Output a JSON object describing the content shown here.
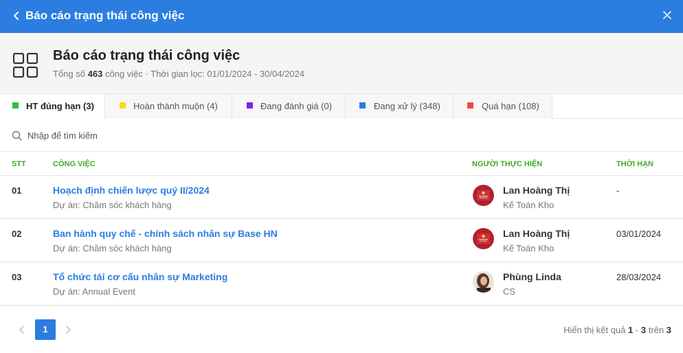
{
  "topbar": {
    "title": "Báo cáo trạng thái công việc",
    "back_icon": "chevron-left-icon",
    "close_icon": "close-icon",
    "color": "#2b7de0"
  },
  "header": {
    "icon": "grid-icon",
    "title": "Báo cáo trạng thái công việc",
    "total_prefix": "Tổng số",
    "total_count": "463",
    "total_suffix": "công việc · Thời gian lọc: 01/01/2024 - 30/04/2024"
  },
  "tabs": [
    {
      "label": "HT đúng hạn (3)",
      "color": "#2ebd3b",
      "active": true
    },
    {
      "label": "Hoàn thành muộn (4)",
      "color": "#f2dd1a",
      "active": false
    },
    {
      "label": "Đang đánh giá (0)",
      "color": "#7a2ae0",
      "active": false
    },
    {
      "label": "Đang xử lý (348)",
      "color": "#2b7de0",
      "active": false
    },
    {
      "label": "Quá hạn (108)",
      "color": "#f04a40",
      "active": false
    }
  ],
  "search": {
    "placeholder": "Nhập để tìm kiếm",
    "value": ""
  },
  "table": {
    "headers": {
      "stt": "STT",
      "task": "CÔNG VIỆC",
      "assignee": "NGƯỜI THỰC HIỆN",
      "deadline": "THỜI HẠN"
    },
    "rows": [
      {
        "stt": "01",
        "task": "Hoạch định chiến lược quý II/2024",
        "project": "Dự án: Chăm sóc khách hàng",
        "name": "Lan Hoàng Thị",
        "role": "Kế Toán Kho",
        "deadline": "-",
        "avatar": "logo-avatar"
      },
      {
        "stt": "02",
        "task": "Ban hành quy chế - chính sách nhân sự Base HN",
        "project": "Dự án: Chăm sóc khách hàng",
        "name": "Lan Hoàng Thị",
        "role": "Kế Toán Kho",
        "deadline": "03/01/2024",
        "avatar": "logo-avatar"
      },
      {
        "stt": "03",
        "task": "Tổ chức tái cơ cấu nhân sự Marketing",
        "project": "Dự án: Annual Event",
        "name": "Phùng Linda",
        "role": "CS",
        "deadline": "28/03/2024",
        "avatar": "photo-avatar"
      }
    ]
  },
  "pagination": {
    "current_page": "1",
    "summary_prefix": "Hiển thị kết quả",
    "range_start": "1",
    "range_sep": "-",
    "range_end": "3",
    "of_label": "trên",
    "total": "3"
  }
}
